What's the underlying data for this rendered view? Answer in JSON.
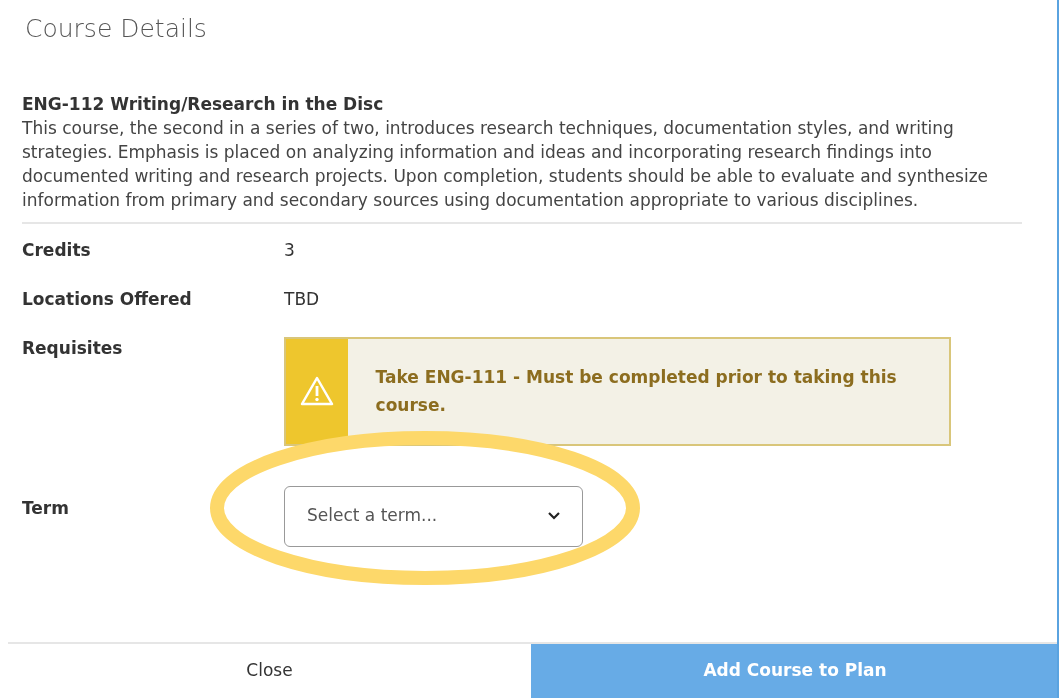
{
  "dialog": {
    "title": "Course Details"
  },
  "course": {
    "title": "ENG-112 Writing/Research in the Disc",
    "description": "This course, the second in a series of two, introduces research techniques, documentation styles, and writing strategies. Emphasis is placed on analyzing information and ideas and incorporating research findings into documented writing and research projects. Upon completion, students should be able to evaluate and synthesize information from primary and secondary sources using documentation appropriate to various disciplines."
  },
  "details": [
    {
      "label": "Credits",
      "value": "3"
    },
    {
      "label": "Locations Offered",
      "value": "TBD"
    }
  ],
  "requisites": {
    "label": "Requisites",
    "alert": "Take ENG-111 - Must be completed prior to taking this course."
  },
  "term": {
    "label": "Term",
    "placeholder": "Select a term...",
    "highlighted": true
  },
  "buttons": [
    {
      "label": "Close",
      "primary": false
    },
    {
      "label": "Add Course to Plan",
      "primary": true
    }
  ]
}
